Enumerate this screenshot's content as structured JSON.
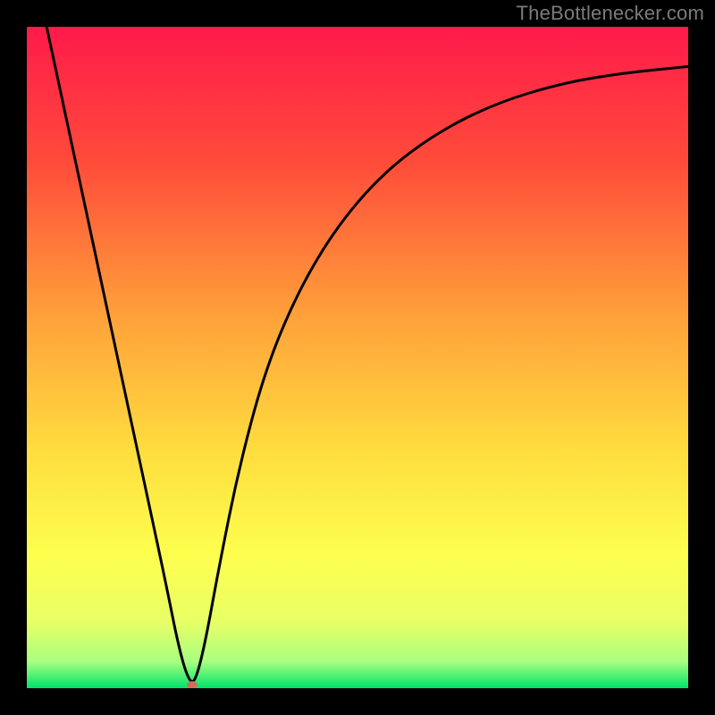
{
  "watermark": "TheBottlenecker.com",
  "chart_data": {
    "type": "line",
    "title": "",
    "xlabel": "",
    "ylabel": "",
    "xlim": [
      0,
      100
    ],
    "ylim": [
      0,
      100
    ],
    "gradient_stops": [
      {
        "offset": 0,
        "color": "#ff1a4b"
      },
      {
        "offset": 20,
        "color": "#ff4a3a"
      },
      {
        "offset": 45,
        "color": "#ffa53a"
      },
      {
        "offset": 65,
        "color": "#ffdf3f"
      },
      {
        "offset": 80,
        "color": "#fdff4f"
      },
      {
        "offset": 90,
        "color": "#e8ff66"
      },
      {
        "offset": 96,
        "color": "#a8ff80"
      },
      {
        "offset": 100,
        "color": "#00e36b"
      }
    ],
    "curve": {
      "comment": "V-shaped bottleneck curve. x is a normalized 0..100 axis, y is 0..100 where 100 = top (bottleneck) and 0 = bottom (optimal).",
      "x": [
        3,
        6,
        9,
        12,
        15,
        18,
        21,
        23,
        24.5,
        25.5,
        27,
        29,
        32,
        36,
        41,
        47,
        54,
        62,
        71,
        81,
        90,
        100
      ],
      "y": [
        100,
        86,
        72,
        58,
        44,
        30,
        16,
        6,
        1,
        1,
        7,
        18,
        33,
        48,
        60,
        70,
        78,
        84,
        88.5,
        91.5,
        93,
        94
      ]
    },
    "marker": {
      "x": 25,
      "y": 0.5,
      "color": "#d66a5a",
      "rx": 6,
      "ry": 4
    }
  }
}
